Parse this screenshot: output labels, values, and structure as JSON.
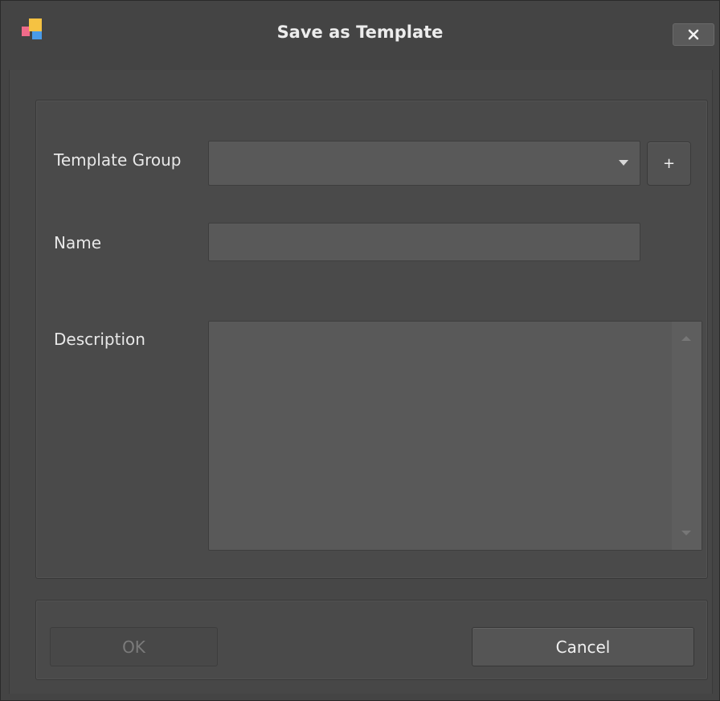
{
  "window": {
    "title": "Save as Template",
    "close_icon": "close-icon",
    "app_icon": "app-logo-icon"
  },
  "form": {
    "template_group": {
      "label": "Template Group",
      "value": "",
      "add_label": "+"
    },
    "name": {
      "label": "Name",
      "value": ""
    },
    "description": {
      "label": "Description",
      "value": ""
    }
  },
  "buttons": {
    "ok_label": "OK",
    "ok_enabled": false,
    "cancel_label": "Cancel"
  },
  "colors": {
    "background": "#444444",
    "input": "#595959",
    "disabled_text": "#7b7b7b"
  }
}
